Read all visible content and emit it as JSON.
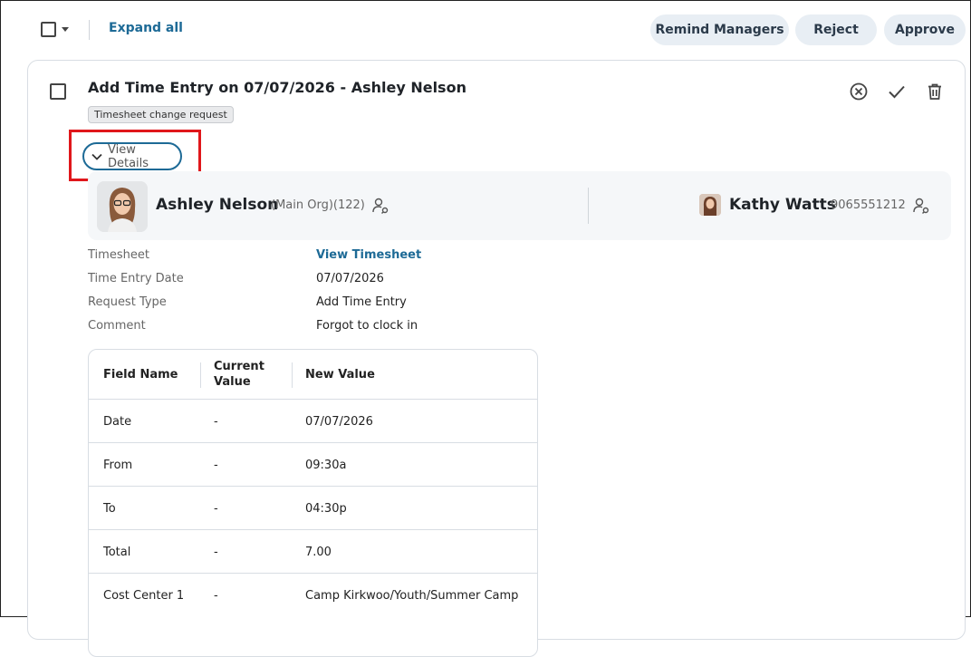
{
  "toolbar": {
    "expand_all": "Expand all",
    "remind_managers": "Remind Managers",
    "reject": "Reject",
    "approve": "Approve"
  },
  "request": {
    "title": "Add Time Entry on 07/07/2026 - Ashley Nelson",
    "tag": "Timesheet change request",
    "view_details": "View Details"
  },
  "employee": {
    "name": "Ashley Nelson",
    "org": "(Main Org)(122)"
  },
  "manager": {
    "name": "Kathy Watts",
    "phone": "9065551212"
  },
  "details": [
    {
      "label": "Timesheet",
      "value": "View Timesheet",
      "link": true
    },
    {
      "label": "Time Entry Date",
      "value": "07/07/2026"
    },
    {
      "label": "Request Type",
      "value": "Add Time Entry"
    },
    {
      "label": "Comment",
      "value": "Forgot to clock in"
    }
  ],
  "table": {
    "headers": [
      "Field Name",
      "Current Value",
      "New Value"
    ],
    "rows": [
      [
        "Date",
        "-",
        "07/07/2026"
      ],
      [
        "From",
        "-",
        "09:30a"
      ],
      [
        "To",
        "-",
        "04:30p"
      ],
      [
        "Total",
        "-",
        "7.00"
      ],
      [
        "Cost Center 1",
        "-",
        "Camp Kirkwoo/Youth/Summer Camp"
      ]
    ]
  },
  "colors": {
    "accent": "#1d6a96",
    "highlight": "#e0171b",
    "pill_bg": "#e8eef4"
  }
}
